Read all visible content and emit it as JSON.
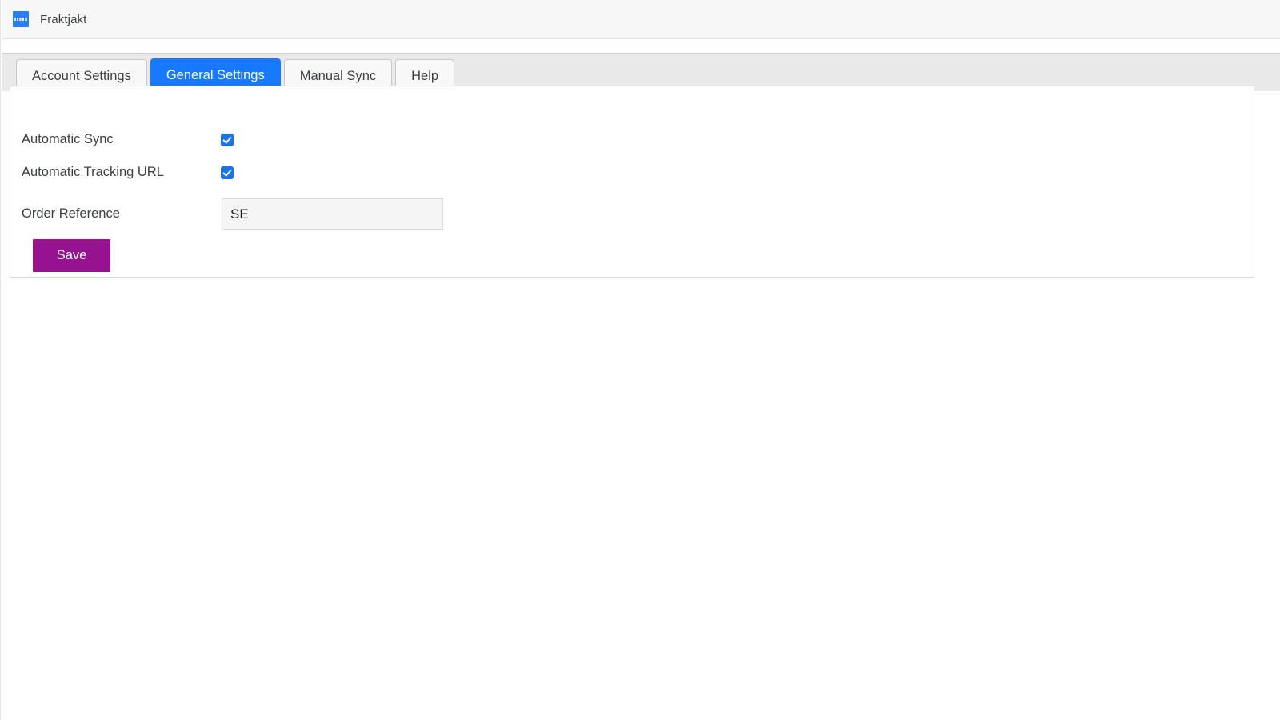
{
  "app": {
    "title": "Fraktjakt",
    "logo_icon": "fraktjakt-logo-icon",
    "accent_blue": "#1779ff",
    "panel_border": "#d6d6d6",
    "tabstrip_bg": "#e9e9e9"
  },
  "tabs": [
    {
      "label": "Account Settings",
      "active": false
    },
    {
      "label": "General Settings",
      "active": true
    },
    {
      "label": "Manual Sync",
      "active": false
    },
    {
      "label": "Help",
      "active": false
    }
  ],
  "form": {
    "automatic_sync": {
      "label": "Automatic Sync",
      "checked": true,
      "checkbox_color": "#1a73e8"
    },
    "automatic_tracking_url": {
      "label": "Automatic Tracking URL",
      "checked": true,
      "checkbox_color": "#1a73e8"
    },
    "order_reference": {
      "label": "Order Reference",
      "value": "SE",
      "placeholder": ""
    },
    "save_button": {
      "label": "Save",
      "color": "#971291"
    }
  }
}
